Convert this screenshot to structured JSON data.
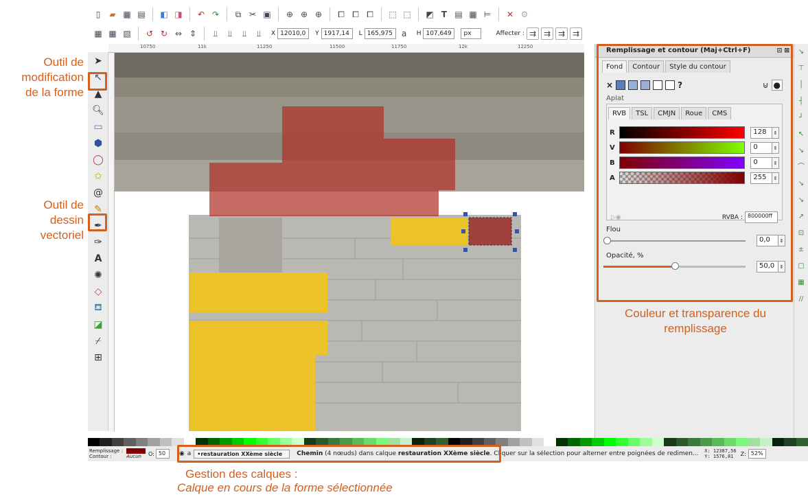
{
  "annotations": {
    "node_tool": [
      "Outil de",
      "modification",
      "de la forme"
    ],
    "pen_tool": [
      "Outil de",
      "dessin",
      "vectoriel"
    ],
    "fill_panel": [
      "Couleur et transparence du",
      "remplissage"
    ],
    "layers_title": "Gestion des calques :",
    "layers_sub": "Calque en cours de la forme sélectionnée"
  },
  "toolbar": {
    "x_label": "X",
    "x_value": "12010,0",
    "y_label": "Y",
    "y_value": "1917,14",
    "l_label": "L",
    "l_value": "165,975",
    "h_label": "H",
    "h_value": "107,649",
    "unit": "px",
    "affecter": "Affecter :"
  },
  "ruler": {
    "ticks": [
      "10750",
      "11k",
      "11250",
      "11500",
      "11750",
      "12k",
      "12250"
    ]
  },
  "panel": {
    "title": "Remplissage et contour (Maj+Ctrl+F)",
    "tabs": [
      "Fond",
      "Contour",
      "Style du contour"
    ],
    "aplat": "Aplat",
    "modes": [
      "RVB",
      "TSL",
      "CMJN",
      "Roue",
      "CMS"
    ],
    "sliders": [
      {
        "label": "R",
        "value": "128"
      },
      {
        "label": "V",
        "value": "0"
      },
      {
        "label": "B",
        "value": "0"
      },
      {
        "label": "A",
        "value": "255"
      }
    ],
    "rvba_label": "RVBA :",
    "rvba_value": "800000ff",
    "flou_label": "Flou",
    "flou_value": "0,0",
    "opacity_label": "Opacité, %",
    "opacity_value": "50,0",
    "opacity_fraction": 0.5,
    "question": "?"
  },
  "status": {
    "fill_label": "Remplissage :",
    "stroke_label": "Contour :",
    "stroke_value": "Aucun",
    "o_label": "O:",
    "o_value": "50",
    "layer": "•restauration XXème siècle",
    "msg_bold1": "Chemin",
    "msg_mid": " (4 nœuds) dans calque ",
    "msg_bold2": "restauration XXème siècle",
    "msg_end": ". Cliquer sur la sélection pour alterner entre poignées de redimen...",
    "x_coord": "X: 12387,56",
    "y_coord": "Y:  1576,81",
    "z_label": "Z:",
    "zoom": "52%"
  },
  "colors": {
    "accent": "#d35f1a",
    "fill": "#800000",
    "red_overlay": "#b03028",
    "yellow_overlay": "#f2c418"
  }
}
